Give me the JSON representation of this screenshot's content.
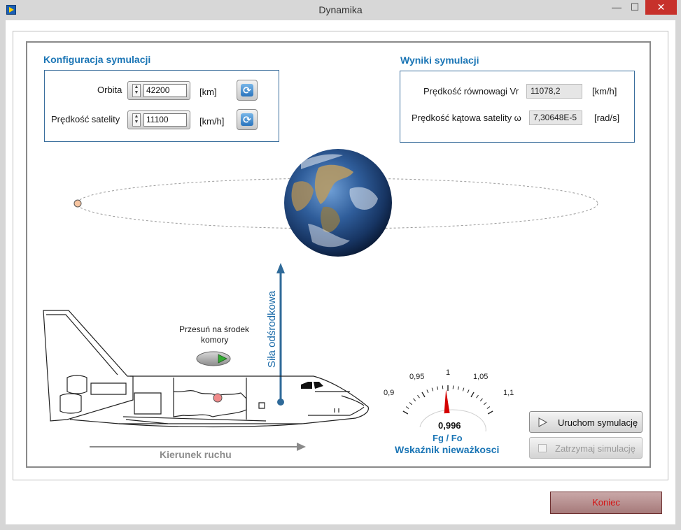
{
  "window": {
    "title": "Dynamika",
    "minimize_glyph": "—",
    "maximize_glyph": "☐",
    "close_glyph": "✕"
  },
  "config": {
    "title": "Konfiguracja symulacji",
    "orbit": {
      "label": "Orbita",
      "value": "42200",
      "unit": "[km]"
    },
    "velocity": {
      "label": "Prędkość satelity",
      "value": "11100",
      "unit": "[km/h]"
    }
  },
  "results": {
    "title": "Wyniki symulacji",
    "vr": {
      "label": "Prędkość równowagi Vr",
      "value": "11078,2",
      "unit": "[km/h]"
    },
    "omega": {
      "label": "Prędkość kątowa satelity ω",
      "value": "7,30648E-5",
      "unit": "[rad/s]"
    }
  },
  "scene": {
    "center_button_label_line1": "Przesuń na środek",
    "center_button_label_line2": "komory",
    "force_label": "Siła odśrodkowa",
    "direction_label": "Kierunek ruchu"
  },
  "gauge": {
    "ticks": [
      "0,9",
      "0,95",
      "1",
      "1,05",
      "1,1"
    ],
    "value": 0.996,
    "value_text": "0,996",
    "min": 0.9,
    "max": 1.1,
    "unit": "Fg / Fo",
    "title": "Wskaźnik nieważkosci"
  },
  "buttons": {
    "start": "Uruchom symulację",
    "stop": "Zatrzymaj simulację",
    "end": "Koniec"
  },
  "colors": {
    "accent": "#1a75b5",
    "arrow": "#2f6a99",
    "needle": "#d40000",
    "close_red": "#c7312b"
  },
  "icons": {
    "refresh": "refresh-icon",
    "play": "play-icon"
  }
}
